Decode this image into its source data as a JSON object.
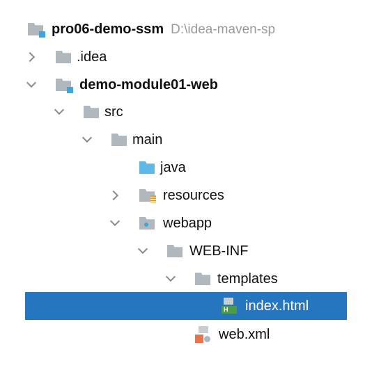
{
  "tree": {
    "root": {
      "label": "pro06-demo-ssm",
      "path": "D:\\idea-maven-sp"
    },
    "idea": ".idea",
    "module": "demo-module01-web",
    "src": "src",
    "main": "main",
    "java": "java",
    "resources": "resources",
    "webapp": "webapp",
    "webinf": "WEB-INF",
    "templates": "templates",
    "index": "index.html",
    "webxml": "web.xml"
  },
  "colors": {
    "selection": "#2675bf",
    "folder": "#b0b7bd",
    "module_badge": "#3ba7e0"
  }
}
